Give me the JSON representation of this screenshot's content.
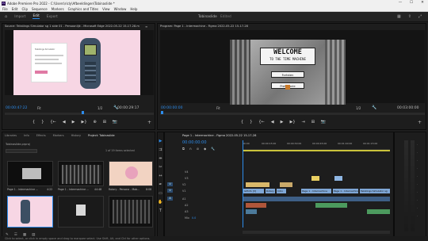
{
  "window": {
    "title": "Adobe Premiere Pro 2022 - C:\\Users\\ricly\\Afbeeldingen\\Tobinaslide *",
    "controls": [
      "—",
      "☐",
      "✕"
    ]
  },
  "menu": [
    "File",
    "Edit",
    "Clip",
    "Sequence",
    "Markers",
    "Graphics and Titles",
    "View",
    "Window",
    "Help"
  ],
  "workspace": {
    "tabs": [
      "Import",
      "Edit",
      "Export"
    ],
    "active": "Edit",
    "project_name": "Tobinaslide",
    "edited_label": "Edited"
  },
  "source_monitor": {
    "title": "Source: Tekstings Simulator sg 1 side 01 - Persoonlijk - Microsoft Edge 2022-05-22 15-17-28.mp",
    "timecode_in": "00:00:47:22",
    "fit": "Fit",
    "fraction": "1/2",
    "timecode_out": "00:00:29:17",
    "page_text": "Tekstings Simulator",
    "buttons": [
      "{",
      "}",
      "{←",
      "◀",
      "▶",
      "▶}",
      "⊕",
      "⊞",
      "📷"
    ]
  },
  "program_monitor": {
    "title": "Program: Page 1 - Intermachine - Figma 2022-05-22 15-17-28",
    "timecode_in": "00:00:00:00",
    "fit": "Fit",
    "fraction": "1/2",
    "timecode_out": "00:03:00:00",
    "welcome_line1": "WELCOME",
    "welcome_line2": "TO THE TIME MACHINE",
    "btn1": "Fortsten",
    "btn2": "Prehistorie",
    "buttons": [
      "{",
      "}",
      "{←",
      "◀",
      "▶",
      "▶}",
      "⇥",
      "⊞",
      "📷"
    ]
  },
  "project_panel": {
    "tabs": [
      "Libraries",
      "Info",
      "Effects",
      "Markers",
      "History",
      "Project: Tobinaslide"
    ],
    "active_tab": "Project: Tobinaslide",
    "path": "Tobinaslide.prproj",
    "items_selected": "1 of 19 items selected",
    "items": [
      {
        "label": "Page 1 - Intermachine ...",
        "duration": "4:22"
      },
      {
        "label": "Page 1 - Intermachine ...",
        "duration": "44:48"
      },
      {
        "label": "Rotary - Persona - Mob...",
        "duration": "8:08"
      },
      {
        "label": "",
        "duration": ""
      },
      {
        "label": "",
        "duration": ""
      },
      {
        "label": "",
        "duration": ""
      }
    ]
  },
  "timeline": {
    "tab": "Page 1 - Intermachine - Figma 2022-05-22 15-17-28",
    "timecode": "00:00:00:00",
    "ruler": [
      "00:00",
      "00:00:15:00",
      "00:00:30:00",
      "00:00:45:00",
      "00:01:00:00",
      "00:01:15:00",
      "00:01:30:00",
      "00:01:45:00",
      "00:02:00:00"
    ],
    "tracks": [
      {
        "name": "V4"
      },
      {
        "name": "V3"
      },
      {
        "name": "V2"
      },
      {
        "name": "V1"
      },
      {
        "name": "A1"
      },
      {
        "name": "A2"
      },
      {
        "name": "A3"
      },
      {
        "name": "Mix"
      }
    ],
    "clips_v1": [
      "Gifinfo [V]",
      "Rotary",
      "Intro",
      "Page 1 - Internachine",
      "Page 1 - Internachine - Figma 2022-05-22...",
      "Tekstings Simulator sg"
    ],
    "mix_value": "0.0"
  },
  "statusbar": "Click to select, or click in empty space and drag to marquee select. Use Shift, Alt, and Ctrl for other options.",
  "colors": {
    "accent": "#2d8ceb",
    "clip_video": "#7fa7d6",
    "clip_audio": "#4c9a5e",
    "playhead": "#2d8ceb"
  }
}
